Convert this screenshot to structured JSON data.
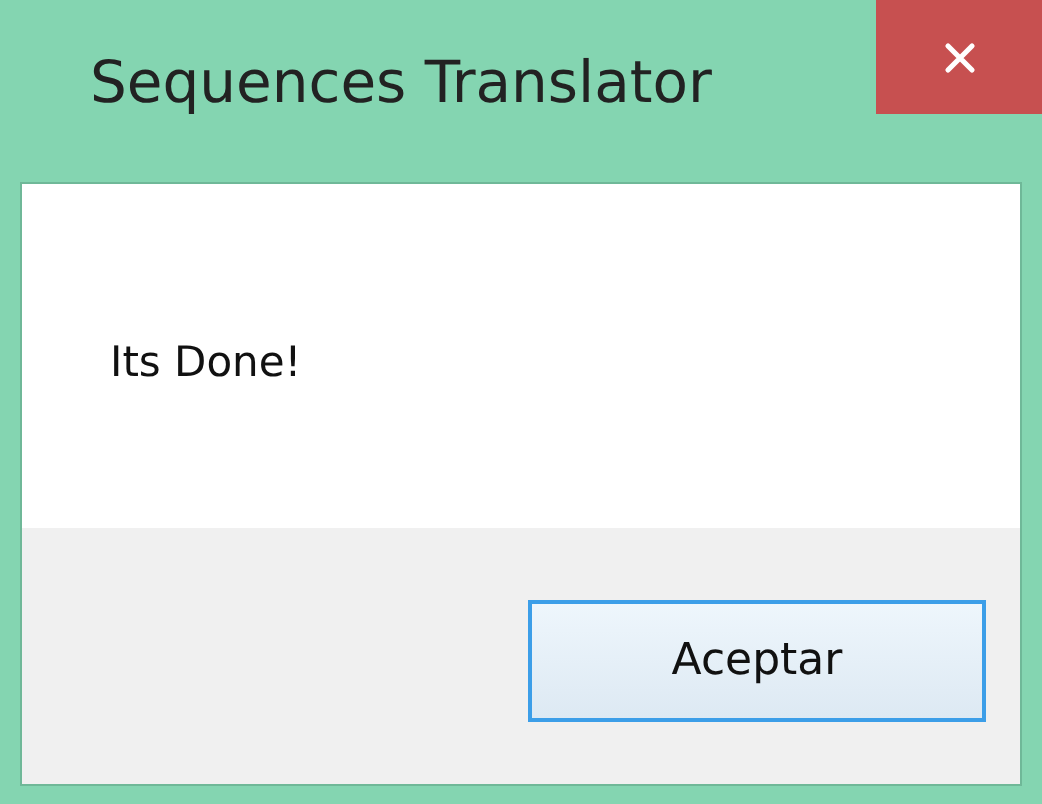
{
  "window": {
    "title": "Sequences Translator"
  },
  "message": "Its Done!",
  "buttons": [
    {
      "label": "Aceptar",
      "focused": true
    }
  ]
}
